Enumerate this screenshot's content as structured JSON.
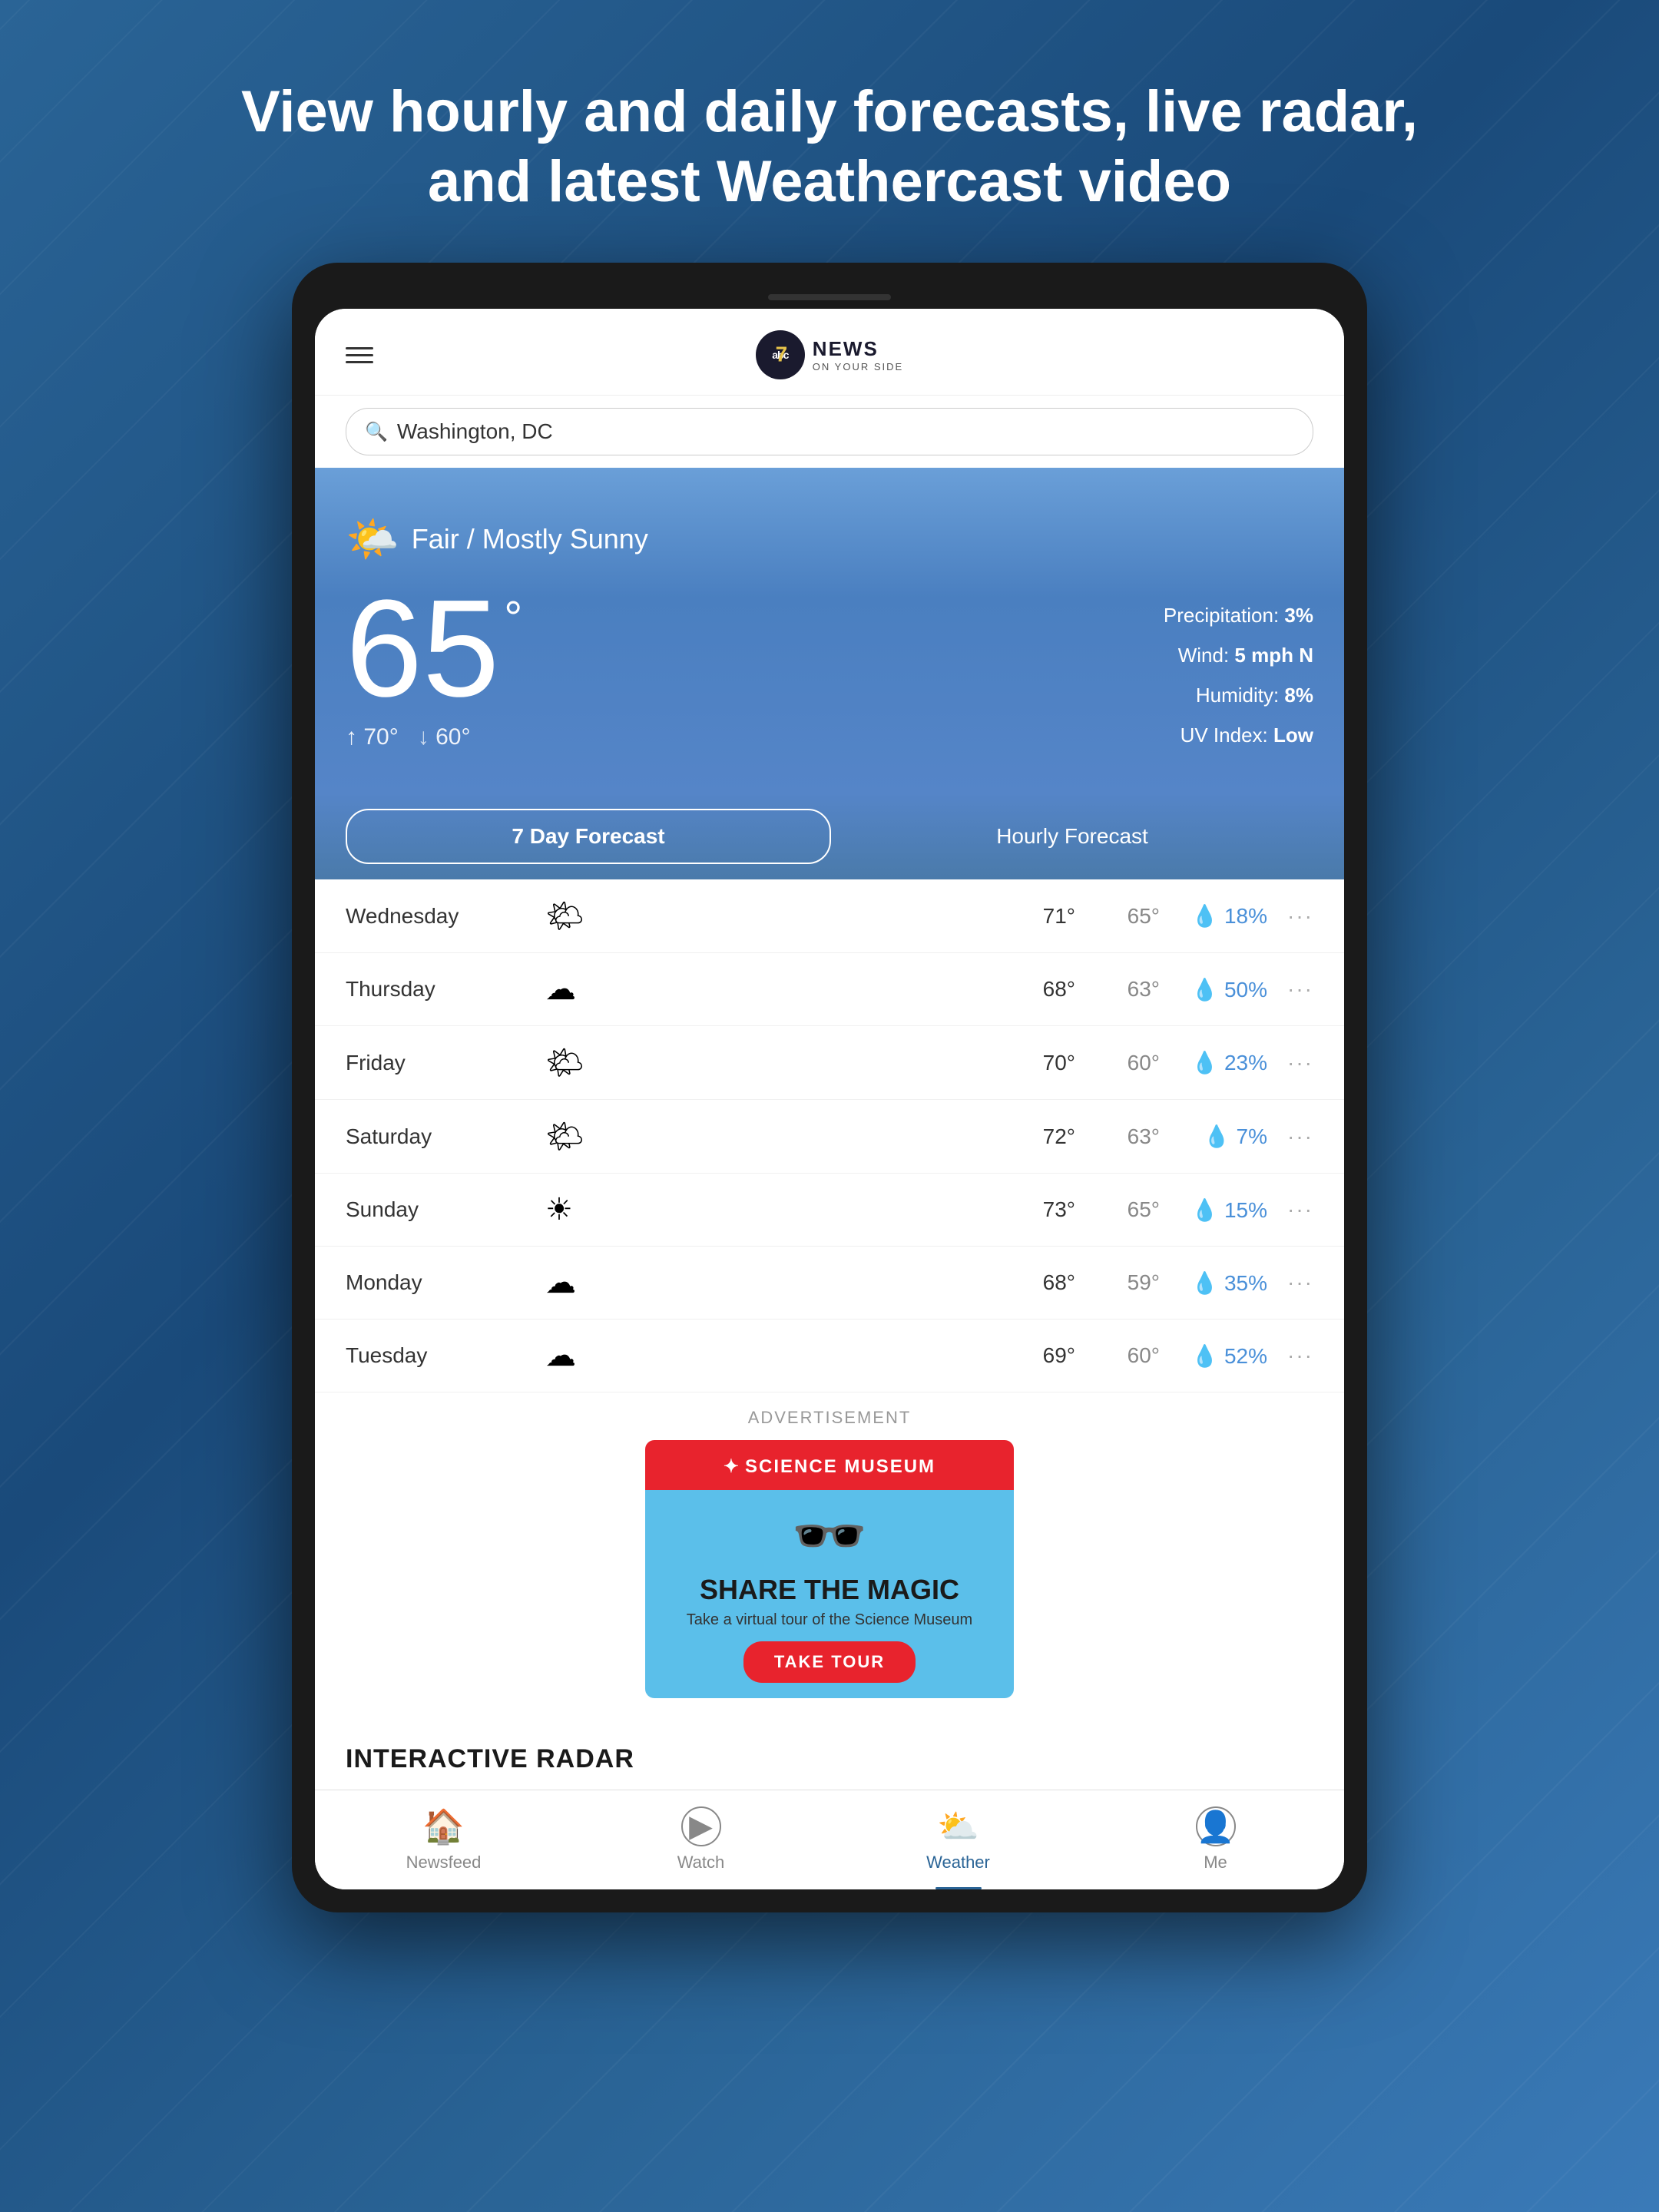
{
  "page": {
    "header_line1": "View hourly and daily forecasts, live radar,",
    "header_line2": "and latest Weathercast video"
  },
  "app": {
    "logo": {
      "abc_text": "abc",
      "number": "7",
      "news_text": "NEWS",
      "subtitle": "ON YOUR SIDE"
    },
    "search": {
      "placeholder": "Washington, DC",
      "value": "Washington, DC"
    },
    "weather": {
      "condition": "Fair / Mostly Sunny",
      "temperature": "65",
      "degree_symbol": "°",
      "high": "70°",
      "low": "60°",
      "precipitation_label": "Precipitation:",
      "precipitation_value": "3%",
      "wind_label": "Wind:",
      "wind_value": "5 mph N",
      "humidity_label": "Humidity:",
      "humidity_value": "8%",
      "uv_label": "UV Index:",
      "uv_value": "Low"
    },
    "forecast": {
      "tab_7day": "7 Day Forecast",
      "tab_hourly": "Hourly Forecast",
      "days": [
        {
          "name": "Wednesday",
          "icon": "🌤",
          "high": "71°",
          "low": "65°",
          "precip": "18%"
        },
        {
          "name": "Thursday",
          "icon": "☁",
          "high": "68°",
          "low": "63°",
          "precip": "50%"
        },
        {
          "name": "Friday",
          "icon": "🌤",
          "high": "70°",
          "low": "60°",
          "precip": "23%"
        },
        {
          "name": "Saturday",
          "icon": "🌤",
          "high": "72°",
          "low": "63°",
          "precip": "7%"
        },
        {
          "name": "Sunday",
          "icon": "☀",
          "high": "73°",
          "low": "65°",
          "precip": "15%"
        },
        {
          "name": "Monday",
          "icon": "☁",
          "high": "68°",
          "low": "59°",
          "precip": "35%"
        },
        {
          "name": "Tuesday",
          "icon": "☁",
          "high": "69°",
          "low": "60°",
          "precip": "52%"
        }
      ]
    },
    "ad": {
      "label": "ADVERTISEMENT",
      "museum_name": "SCIENCE MUSEUM",
      "share_text": "SHARE THE MAGIC",
      "sub_text": "Take a virtual tour of the Science Museum",
      "button_text": "TAKE TOUR"
    },
    "radar": {
      "title": "INTERACTIVE RADAR"
    },
    "nav": {
      "items": [
        {
          "id": "newsfeed",
          "label": "Newsfeed",
          "icon": "🏠",
          "active": false
        },
        {
          "id": "watch",
          "label": "Watch",
          "icon": "▶",
          "active": false
        },
        {
          "id": "weather",
          "label": "Weather",
          "icon": "⛅",
          "active": true
        },
        {
          "id": "me",
          "label": "Me",
          "icon": "👤",
          "active": false
        }
      ]
    }
  }
}
